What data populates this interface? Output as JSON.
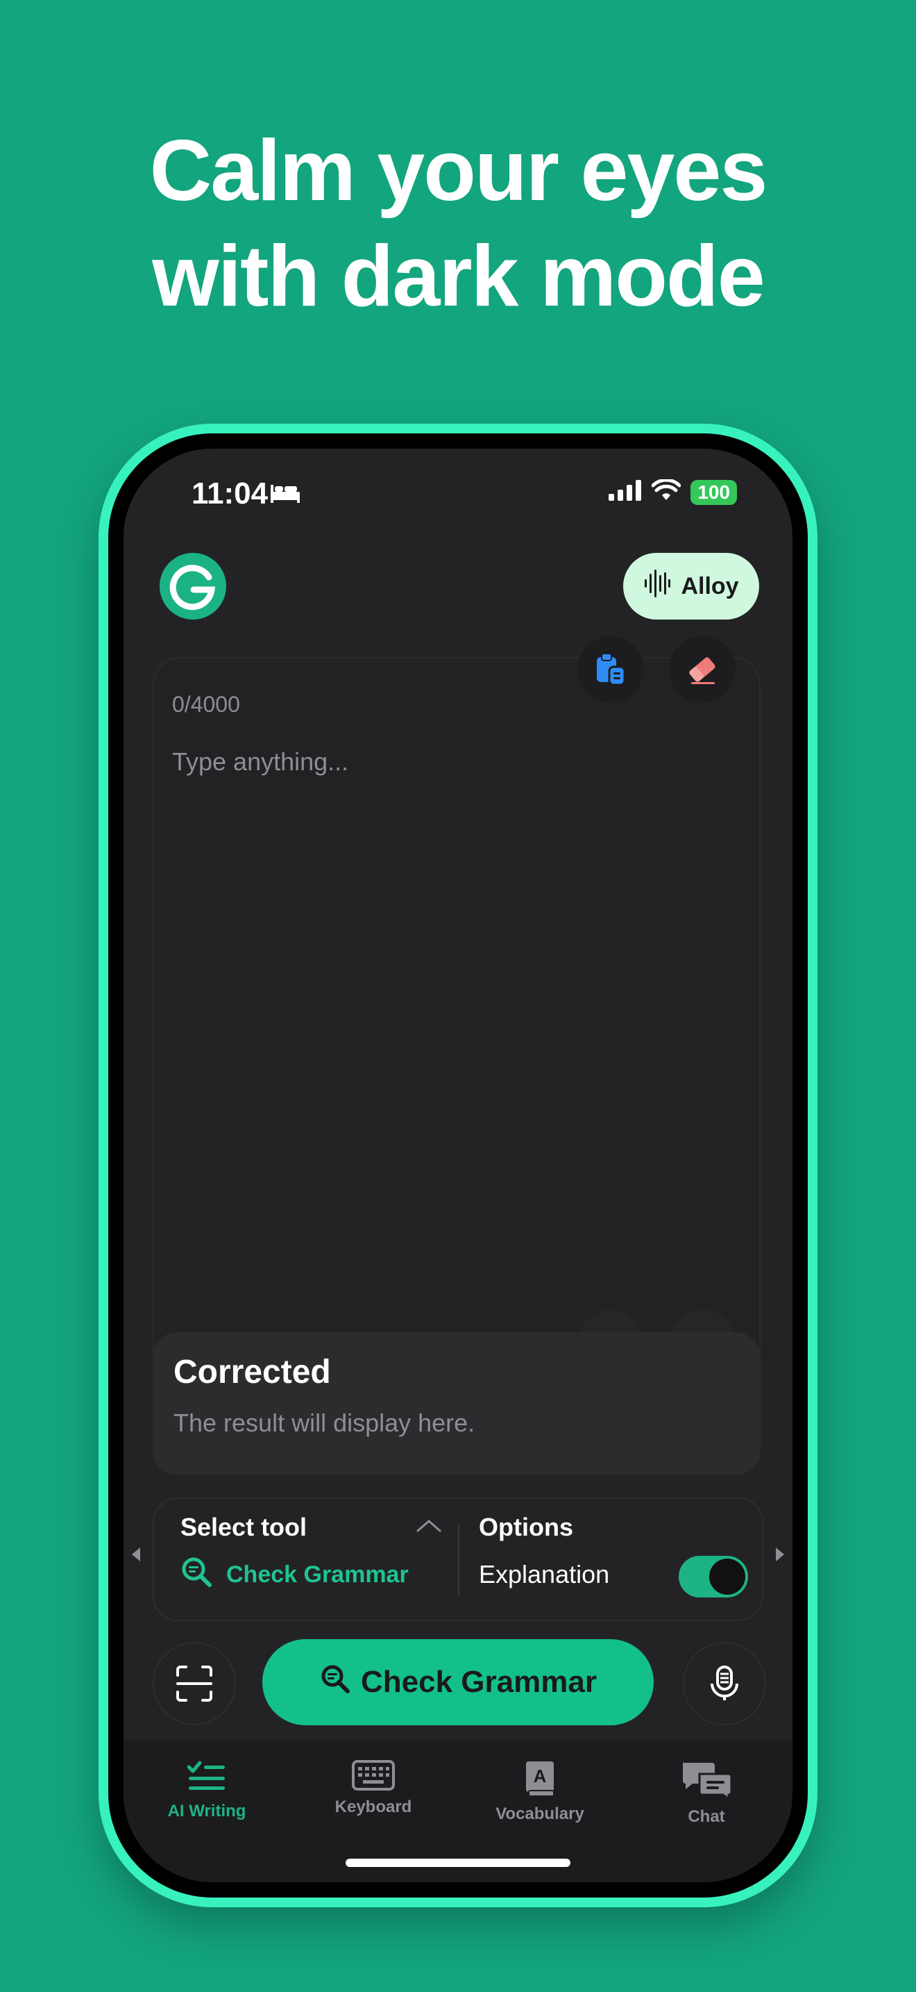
{
  "headline": {
    "line1": "Calm your eyes",
    "line2": "with dark mode"
  },
  "status_bar": {
    "time": "11:04",
    "battery": "100"
  },
  "header": {
    "voice_button_label": "Alloy"
  },
  "editor": {
    "counter": "0/4000",
    "placeholder": "Type anything..."
  },
  "result": {
    "title": "Corrected",
    "placeholder": "The result will display here."
  },
  "tool_panel": {
    "select_tool_label": "Select tool",
    "active_tool": "Check Grammar",
    "options_label": "Options",
    "explanation_label": "Explanation",
    "explanation_enabled": true
  },
  "action": {
    "check_button_label": "Check Grammar"
  },
  "tabs": [
    {
      "label": "AI Writing",
      "icon": "ai-writing-icon",
      "active": true
    },
    {
      "label": "Keyboard",
      "icon": "keyboard-icon",
      "active": false
    },
    {
      "label": "Vocabulary",
      "icon": "vocabulary-icon",
      "active": false
    },
    {
      "label": "Chat",
      "icon": "chat-icon",
      "active": false
    }
  ],
  "colors": {
    "background": "#13A57D",
    "phone_frame": "#38F2BE",
    "screen": "#232325",
    "accent": "#13C08A",
    "alloy_button": "#CFF8DF"
  }
}
